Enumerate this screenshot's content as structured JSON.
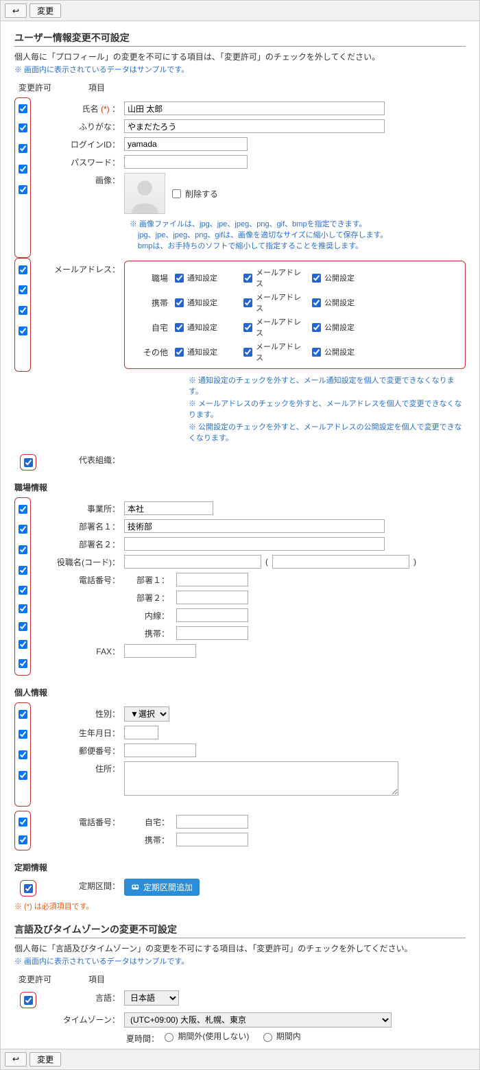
{
  "toolbar": {
    "back_glyph": "↩",
    "change_label": "変更"
  },
  "section1": {
    "title": "ユーザー情報変更不可設定",
    "desc": "個人毎に「プロフィール」の変更を不可にする項目は、「変更許可」のチェックを外してください。",
    "note": "※ 画面内に表示されているデータはサンプルです。"
  },
  "columns": {
    "perm": "変更許可",
    "item": "項目"
  },
  "fields": {
    "name_label": "氏名",
    "required_mark": "(*)",
    "colon": "：",
    "name_value": "山田 太郎",
    "kana_label": "ふりがな",
    "kana_value": "やまだたろう",
    "login_label": "ログインID",
    "login_value": "yamada",
    "password_label": "パスワード",
    "image_label": "画像",
    "image_delete": "削除する",
    "image_note1": "※ 画像ファイルは、jpg、jpe、jpeg、png、gif、bmpを指定できます。",
    "image_note2": "jpg、jpe、jpeg、png、gifは、画像を適切なサイズに縮小して保存します。",
    "image_note3": "bmpは、お手持ちのソフトで縮小して指定することを推奨します。",
    "mail_label": "メールアドレス",
    "mail_rows": [
      {
        "label": "職場"
      },
      {
        "label": "携帯"
      },
      {
        "label": "自宅"
      },
      {
        "label": "その他"
      }
    ],
    "mail_cols": {
      "notify": "通知設定",
      "addr": "メールアドレス",
      "public": "公開設定"
    },
    "mail_note1": "※ 通知設定のチェックを外すと、メール通知設定を個人で変更できなくなります。",
    "mail_note2": "※ メールアドレスのチェックを外すと、メールアドレスを個人で変更できなくなります。",
    "mail_note3": "※ 公開設定のチェックを外すと、メールアドレスの公開設定を個人で変更できなくなります。",
    "org_label": "代表組織"
  },
  "work": {
    "heading": "職場情報",
    "office_label": "事業所",
    "office_value": "本社",
    "dept1_label": "部署名１",
    "dept1_value": "技術部",
    "dept2_label": "部署名２",
    "title_label": "役職名(コード)",
    "paren_open": "(",
    "paren_close": ")",
    "phone_label": "電話番号",
    "phone_sub1": "部署１",
    "phone_sub2": "部署２",
    "phone_ext": "内線",
    "phone_cell": "携帯",
    "fax_label": "FAX"
  },
  "personal": {
    "heading": "個人情報",
    "sex_label": "性別",
    "sex_select": "▼選択",
    "birth_label": "生年月日",
    "zip_label": "郵便番号",
    "address_label": "住所",
    "phone_label": "電話番号",
    "phone_home": "自宅",
    "phone_cell": "携帯"
  },
  "commuter": {
    "heading": "定期情報",
    "label": "定期区間",
    "button": "定期区間追加"
  },
  "required_note": "※ (*) は必須項目です。",
  "section2": {
    "title": "言語及びタイムゾーンの変更不可設定",
    "desc": "個人毎に「言語及びタイムゾーン」の変更を不可にする項目は、「変更許可」のチェックを外してください。",
    "note": "※ 画面内に表示されているデータはサンプルです。",
    "lang_label": "言語",
    "lang_value": "日本語",
    "tz_label": "タイムゾーン",
    "tz_value": "(UTC+09:00) 大阪、札幌、東京",
    "dst_label": "夏時間：",
    "dst_off": "期間外(使用しない)",
    "dst_on": "期間内"
  }
}
